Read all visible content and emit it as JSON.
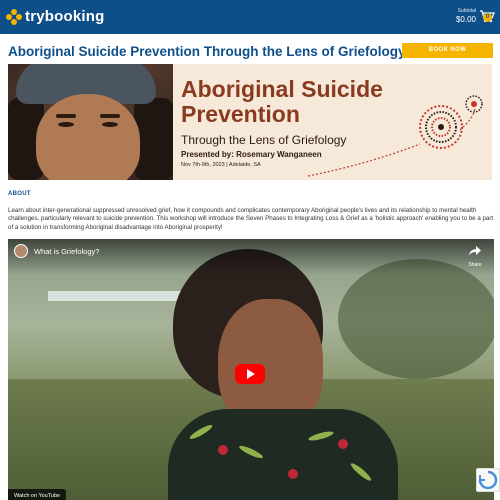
{
  "header": {
    "logo_text": "trybooking",
    "subtotal_label": "Subtotal",
    "subtotal_value": "$0.00",
    "cart_count": "0",
    "brand_color": "#0e4f8a",
    "accent_color": "#f4b400"
  },
  "event": {
    "title": "Aboriginal Suicide Prevention Through the Lens of Griefology",
    "book_label": "BOOK NOW"
  },
  "banner": {
    "heading_line1": "Aboriginal Suicide",
    "heading_line2": "Prevention",
    "subtitle": "Through the Lens of Griefology",
    "presenter": "Presented by: Rosemary Wanganeen",
    "date_location": "Nov 7th-9th, 2023  |  Adelaide, SA"
  },
  "about": {
    "label": "ABOUT",
    "text": "Learn about inter-generational suppressed unresolved grief, how it compounds and complicates contemporary Aboriginal people's lives and its relationship to mental health challenges, particularly relevant to suicide prevention. This workshop will introduce the Seven Phases to Integrating Loss & Grief as a 'holistic approach' enabling you to be a part of a solution in transforming Aboriginal disadvantage into Aboriginal prosperity!"
  },
  "video": {
    "title": "What is Griefology?",
    "share_label": "Share",
    "watch_on_label": "Watch on  YouTube",
    "play_icon": "play-icon"
  }
}
